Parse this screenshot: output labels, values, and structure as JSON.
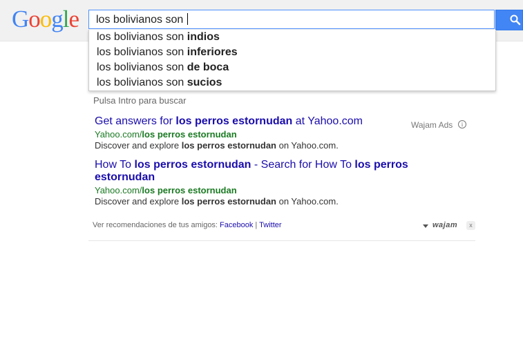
{
  "logo": {
    "letters": [
      "G",
      "o",
      "o",
      "g",
      "l",
      "e"
    ],
    "colors": [
      "#4285f4",
      "#ea4335",
      "#fbbc05",
      "#4285f4",
      "#34a853",
      "#ea4335"
    ]
  },
  "search": {
    "query": "los bolivianos son "
  },
  "suggestions": [
    {
      "prefix": "los bolivianos son ",
      "bold": "indios"
    },
    {
      "prefix": "los bolivianos son ",
      "bold": "inferiores"
    },
    {
      "prefix": "los bolivianos son ",
      "bold": "de boca"
    },
    {
      "prefix": "los bolivianos son ",
      "bold": "sucios"
    }
  ],
  "hint": "Pulsa Intro para buscar",
  "ads_label": "Wajam Ads",
  "ads": [
    {
      "title_pre": "Get answers for ",
      "title_bold": "los perros estornudan",
      "title_post": " at Yahoo.com",
      "title_bold2": "",
      "title_line2": "",
      "url_pre": "Yahoo.com/",
      "url_bold": "los perros estornudan",
      "desc_pre": "Discover and explore ",
      "desc_bold": "los perros estornudan",
      "desc_post": " on Yahoo.com."
    },
    {
      "title_pre": "How To ",
      "title_bold": "los perros estornudan",
      "title_post": " - Search for How To ",
      "title_bold2": "los perros",
      "title_line2": "estornudan",
      "url_pre": "Yahoo.com/",
      "url_bold": "los perros estornudan",
      "desc_pre": "Discover and explore ",
      "desc_bold": "los perros estornudan",
      "desc_post": " on Yahoo.com."
    }
  ],
  "footer": {
    "text": "Ver recomendaciones de tus amigos: ",
    "link1": "Facebook",
    "sep": " | ",
    "link2": "Twitter"
  },
  "brand": "wajam",
  "close": "x",
  "info": "i"
}
